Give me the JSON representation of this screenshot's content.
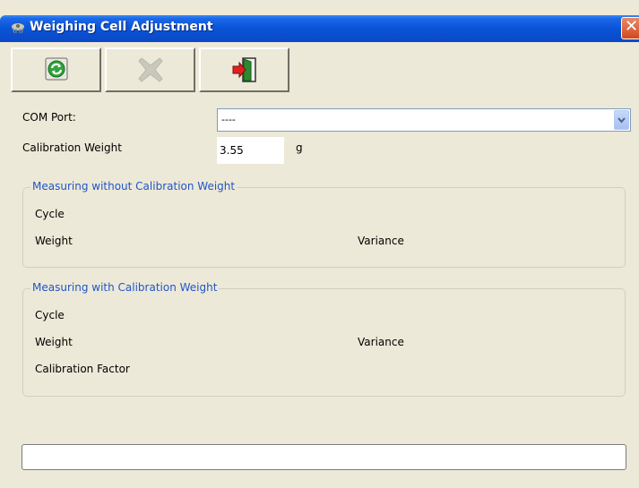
{
  "window": {
    "title": "Weighing Cell Adjustment",
    "close_glyph": "✕"
  },
  "toolbar": {
    "buttons": [
      {
        "icon": "refresh-icon",
        "enabled": true
      },
      {
        "icon": "cancel-icon",
        "enabled": false
      },
      {
        "icon": "exit-icon",
        "enabled": true
      }
    ]
  },
  "form": {
    "com_port_label": "COM Port:",
    "com_port_value": "----",
    "calibration_weight_label": "Calibration Weight",
    "calibration_weight_value": "3.55",
    "calibration_weight_unit": "g"
  },
  "group_without": {
    "title": "Measuring without Calibration Weight",
    "cycle_label": "Cycle",
    "weight_label": "Weight",
    "variance_label": "Variance"
  },
  "group_with": {
    "title": "Measuring with Calibration Weight",
    "cycle_label": "Cycle",
    "weight_label": "Weight",
    "variance_label": "Variance",
    "calibration_factor_label": "Calibration Factor"
  },
  "status": {
    "text": ""
  },
  "colors": {
    "titlebar": "#0a55d9",
    "group_title": "#2155c6",
    "window_bg": "#ece9d8"
  }
}
